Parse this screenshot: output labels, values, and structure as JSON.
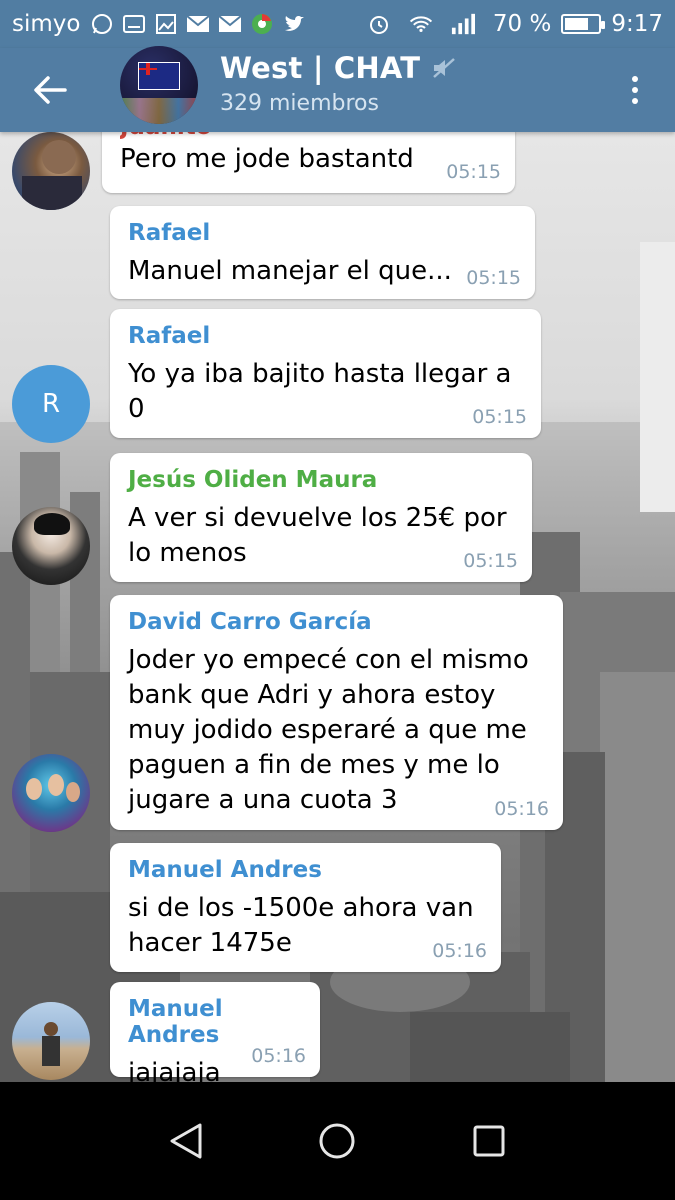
{
  "status_bar": {
    "carrier": "simyo",
    "battery": "70 %",
    "battery_level": 0.7,
    "time": "9:17",
    "icons": [
      "whatsapp-icon",
      "keyboard-icon",
      "image-icon",
      "mail-icon",
      "mail-icon",
      "chrome-icon",
      "twitter-icon",
      "alarm-icon",
      "wifi-icon",
      "signal-icon",
      "battery-icon"
    ]
  },
  "header": {
    "title": "West | CHAT",
    "subtitle": "329 miembros",
    "icons": {
      "back": "arrow-back-icon",
      "muted": "mute-icon",
      "menu": "more-vert-icon"
    }
  },
  "messages": [
    {
      "sender": "Juanito",
      "sender_color": "#d2473d",
      "text": "Pero me jode bastantd",
      "time": "05:15"
    },
    {
      "sender": "Rafael",
      "sender_color": "#3f8fd1",
      "text": "Manuel manejar el que...",
      "time": "05:15"
    },
    {
      "sender": "Rafael",
      "sender_color": "#3f8fd1",
      "text": "Yo ya iba bajito hasta llegar a 0",
      "time": "05:15",
      "avatar_letter": "R",
      "avatar_color": "#4b9bd8"
    },
    {
      "sender": "Jesús Oliden Maura",
      "sender_color": "#4fae45",
      "text": "A ver si devuelve los 25€ por lo menos",
      "time": "05:15"
    },
    {
      "sender": "David Carro García",
      "sender_color": "#3f8fd1",
      "text": "Joder yo empecé con el mismo bank que Adri y ahora estoy muy jodido esperaré a que me paguen a fin de mes y me lo jugare a una cuota 3",
      "time": "05:16"
    },
    {
      "sender": "Manuel Andres",
      "sender_color": "#3f8fd1",
      "text": "si de los -1500e ahora van hacer 1475e",
      "time": "05:16"
    },
    {
      "sender": "Manuel Andres",
      "sender_color": "#3f8fd1",
      "text": "jajajaja",
      "time": "05:16"
    }
  ],
  "navigation": {
    "back": "nav-back-icon",
    "home": "nav-home-icon",
    "recents": "nav-recents-icon"
  },
  "colors": {
    "header": "#527da3",
    "status_bar": "#517da2",
    "bubble": "#ffffff",
    "time": "#8aa0b2"
  }
}
